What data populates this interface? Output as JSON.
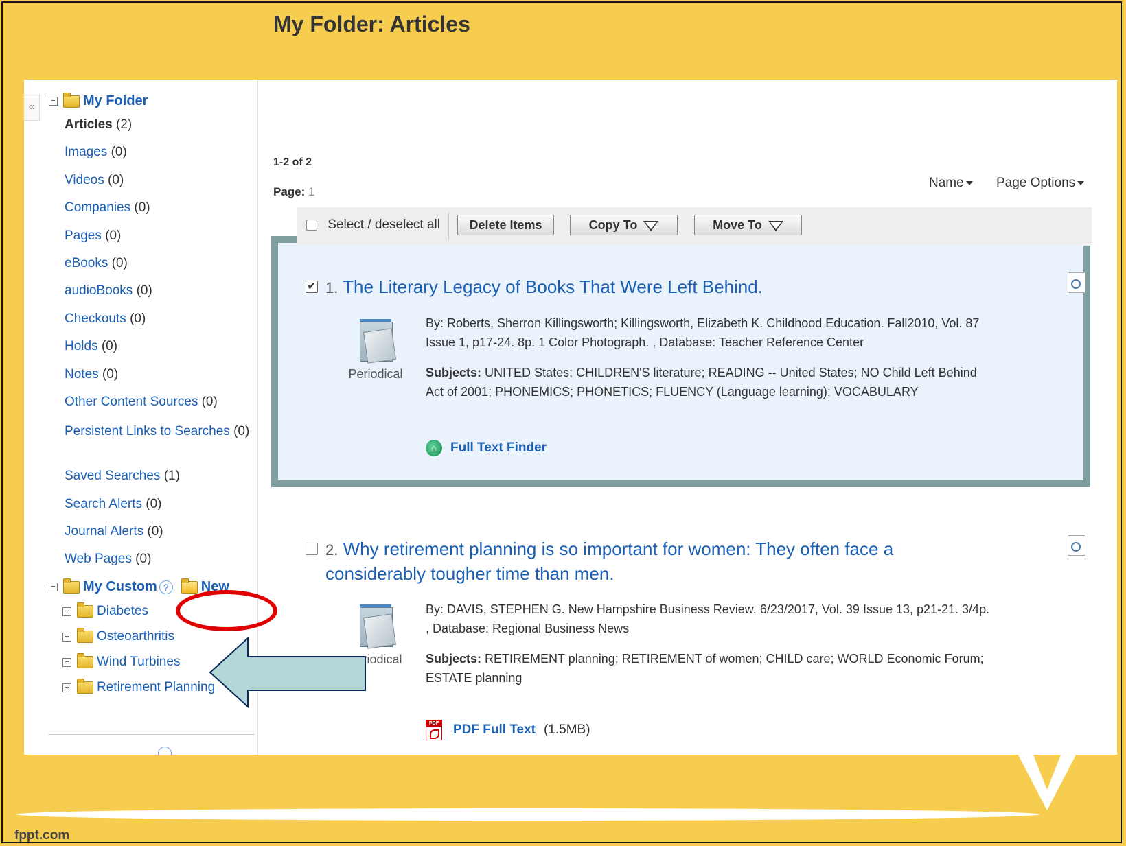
{
  "sidebar": {
    "collapse": "«",
    "my_folder": "My Folder",
    "items": [
      {
        "label": "Articles",
        "count": "(2)"
      },
      {
        "label": "Images",
        "count": "(0)"
      },
      {
        "label": "Videos",
        "count": "(0)"
      },
      {
        "label": "Companies",
        "count": "(0)"
      },
      {
        "label": "Pages",
        "count": "(0)"
      },
      {
        "label": "eBooks",
        "count": "(0)"
      },
      {
        "label": "audioBooks",
        "count": "(0)"
      },
      {
        "label": "Checkouts",
        "count": "(0)"
      },
      {
        "label": "Holds",
        "count": "(0)"
      },
      {
        "label": "Notes",
        "count": "(0)"
      },
      {
        "label": "Other Content Sources",
        "count": "(0)"
      },
      {
        "label": "Persistent Links to Searches",
        "count": "(0)"
      },
      {
        "label": "Saved Searches",
        "count": "(1)"
      },
      {
        "label": "Search Alerts",
        "count": "(0)"
      },
      {
        "label": "Journal Alerts",
        "count": "(0)"
      },
      {
        "label": "Web Pages",
        "count": "(0)"
      }
    ],
    "my_custom": "My Custom",
    "help": "?",
    "new_label": "New",
    "custom_folders": [
      "Diabetes",
      "Osteoarthritis",
      "Wind Turbines",
      "Retirement Planning"
    ]
  },
  "main": {
    "title": "My Folder: Articles",
    "count": "1-2 of 2",
    "page_label": "Page:",
    "page_value": "1",
    "sort_name": "Name",
    "page_options": "Page Options",
    "select_all": "Select / deselect all",
    "delete_items": "Delete Items",
    "copy_to": "Copy To",
    "move_to": "Move To"
  },
  "results": [
    {
      "number": "1.",
      "title": "The Literary Legacy of Books That Were Left Behind.",
      "pub_type": "Periodical",
      "byline_1": "By: Roberts, Sherron Killingsworth; Killingsworth, Elizabeth K. Childhood Education. Fall2010, Vol. 87",
      "byline_2": "Issue 1, p17-24. 8p. 1 Color Photograph. , Database: Teacher Reference Center",
      "subjects_label": "Subjects:",
      "subjects_1": "UNITED States; CHILDREN'S literature; READING -- United States; NO Child Left Behind",
      "subjects_2": "Act of 2001; PHONEMICS; PHONETICS; FLUENCY (Language learning); VOCABULARY",
      "link_label": "Full Text Finder",
      "checked": true
    },
    {
      "number": "2.",
      "title_1": "Why retirement planning is so important for women: They often face a",
      "title_2": "considerably tougher time than men.",
      "pub_type": "riodical",
      "byline_1": "By: DAVIS, STEPHEN G. New Hampshire Business Review. 6/23/2017, Vol. 39 Issue 13, p21-21. 3/4p.",
      "byline_2": ", Database: Regional Business News",
      "subjects_label": "Subjects:",
      "subjects_1": "RETIREMENT planning; RETIREMENT of women; CHILD care; WORLD Economic Forum;",
      "subjects_2": "ESTATE planning",
      "link_label": "PDF Full Text",
      "link_size": "(1.5MB)",
      "checked": false
    }
  ],
  "footer": {
    "brand": "fppt.com"
  },
  "colors": {
    "background": "#f6cd4f",
    "link": "#1a5fb4",
    "highlight_border": "#7f9f9f",
    "annotation_red": "#e00000",
    "arrow_fill": "#b3d7d8"
  }
}
